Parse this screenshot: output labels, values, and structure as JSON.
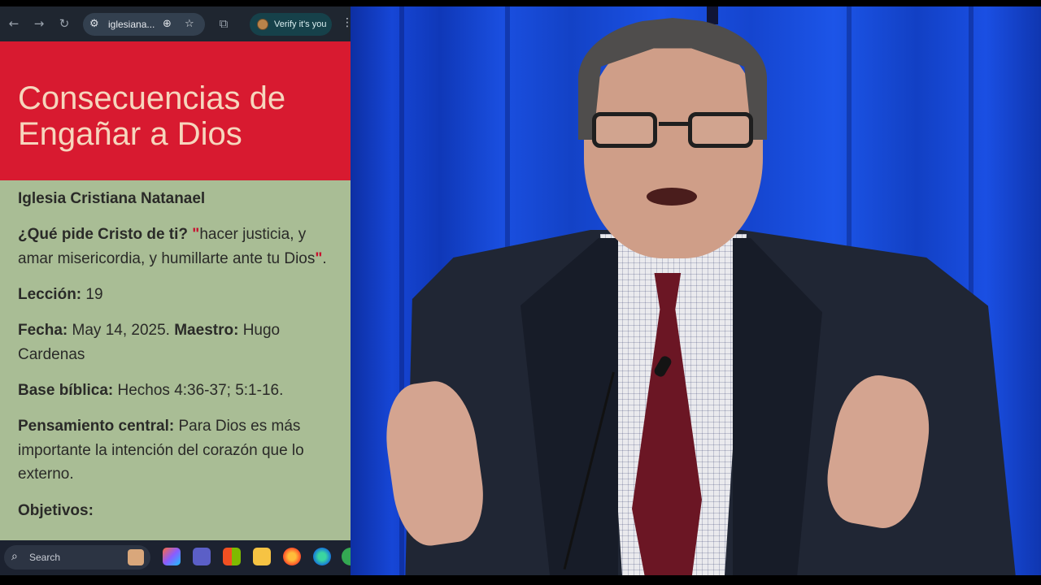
{
  "browser": {
    "url_text": "iglesiana...",
    "verify_label": "Verify it's you",
    "icons": {
      "back": "arrow-left-icon",
      "forward": "arrow-right-icon",
      "reload": "reload-icon",
      "site_info": "site-settings-icon",
      "zoom": "zoom-icon",
      "bookmark": "star-icon",
      "extensions": "puzzle-icon",
      "menu": "more-vertical-icon"
    }
  },
  "page": {
    "title": "Consecuencias de Engañar a Dios",
    "church": "Iglesia Cristiana Natanael",
    "question_label": "¿Qué pide Cristo de ti?",
    "open_quote": "\"",
    "question_text": "hacer justicia, y amar misericordia, y humillarte ante tu Dios",
    "close_quote": "\"",
    "end_punct": ".",
    "lesson_label": "Lección:",
    "lesson_value": "19",
    "date_label": "Fecha:",
    "date_value": "May 14, 2025.",
    "teacher_label": "Maestro:",
    "teacher_value": "Hugo Cardenas",
    "base_label": "Base bíblica:",
    "base_value": "Hechos 4:36-37; 5:1-16.",
    "thought_label": "Pensamiento central:",
    "thought_value": "Para Dios es más importante la intención del corazón que lo externo.",
    "objectives_label": "Objetivos:"
  },
  "taskbar": {
    "search_label": "Search",
    "apps": [
      "copilot-icon",
      "teams-icon",
      "store-icon",
      "file-explorer-icon",
      "firefox-icon",
      "edge-icon",
      "chrome-icon"
    ]
  },
  "colors": {
    "banner": "#d81a30",
    "banner_text": "#f6d6bd",
    "page_bg": "#a9bd95",
    "curtain": "#1646d6"
  }
}
